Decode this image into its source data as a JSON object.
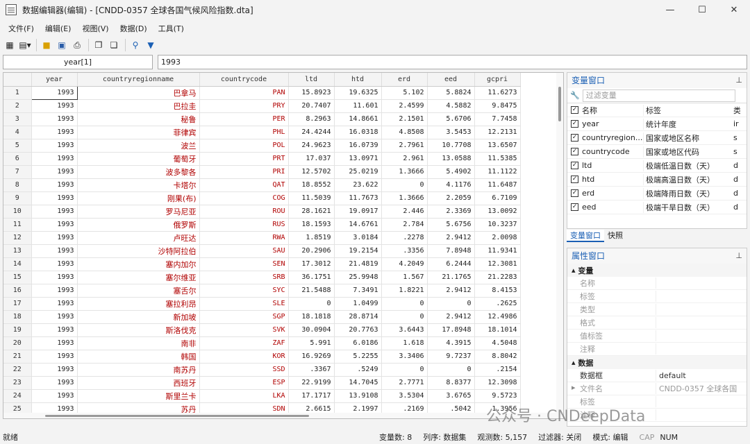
{
  "window": {
    "title": "数据编辑器(编辑) - [CNDD-0357 全球各国气候风险指数.dta]",
    "minimize": "—",
    "maximize": "☐",
    "close": "✕"
  },
  "menu": [
    "文件(F)",
    "编辑(E)",
    "视图(V)",
    "数据(D)",
    "工具(T)"
  ],
  "toolbar_icons": [
    "grid-edit-icon",
    "grid-browse-icon",
    "open-folder-icon",
    "save-icon",
    "print-icon",
    "copy-icon",
    "paste-icon",
    "search-icon",
    "filter-icon"
  ],
  "varbar": {
    "varname": "year[1]",
    "value": "1993"
  },
  "grid": {
    "columns": [
      "year",
      "countryregionname",
      "countrycode",
      "ltd",
      "htd",
      "erd",
      "eed",
      "gcpri"
    ],
    "rows": [
      [
        "1",
        "1993",
        "巴拿马",
        "PAN",
        "15.8923",
        "19.6325",
        "5.102",
        "5.8824",
        "11.6273"
      ],
      [
        "2",
        "1993",
        "巴拉圭",
        "PRY",
        "20.7407",
        "11.601",
        "2.4599",
        "4.5882",
        "9.8475"
      ],
      [
        "3",
        "1993",
        "秘鲁",
        "PER",
        "8.2963",
        "14.8661",
        "2.1501",
        "5.6706",
        "7.7458"
      ],
      [
        "4",
        "1993",
        "菲律宾",
        "PHL",
        "24.4244",
        "16.0318",
        "4.8508",
        "3.5453",
        "12.2131"
      ],
      [
        "5",
        "1993",
        "波兰",
        "POL",
        "24.9623",
        "16.0739",
        "2.7961",
        "10.7708",
        "13.6507"
      ],
      [
        "6",
        "1993",
        "葡萄牙",
        "PRT",
        "17.037",
        "13.0971",
        "2.961",
        "13.0588",
        "11.5385"
      ],
      [
        "7",
        "1993",
        "波多黎各",
        "PRI",
        "12.5702",
        "25.0219",
        "1.3666",
        "5.4902",
        "11.1122"
      ],
      [
        "8",
        "1993",
        "卡塔尔",
        "QAT",
        "18.8552",
        "23.622",
        "0",
        "4.1176",
        "11.6487"
      ],
      [
        "9",
        "1993",
        "刚果(布)",
        "COG",
        "11.5039",
        "11.7673",
        "1.3666",
        "2.2059",
        "6.7109"
      ],
      [
        "10",
        "1993",
        "罗马尼亚",
        "ROU",
        "28.1621",
        "19.0917",
        "2.446",
        "2.3369",
        "13.0092"
      ],
      [
        "11",
        "1993",
        "俄罗斯",
        "RUS",
        "18.1593",
        "14.6761",
        "2.784",
        "5.6756",
        "10.3237"
      ],
      [
        "12",
        "1993",
        "卢旺达",
        "RWA",
        "1.8519",
        "3.0184",
        ".2278",
        "2.9412",
        "2.0098"
      ],
      [
        "13",
        "1993",
        "沙特阿拉伯",
        "SAU",
        "20.2906",
        "19.2154",
        ".3356",
        "7.8948",
        "11.9341"
      ],
      [
        "14",
        "1993",
        "塞内加尔",
        "SEN",
        "17.3012",
        "21.4819",
        "4.2049",
        "6.2444",
        "12.3081"
      ],
      [
        "15",
        "1993",
        "塞尔维亚",
        "SRB",
        "36.1751",
        "25.9948",
        "1.567",
        "21.1765",
        "21.2283"
      ],
      [
        "16",
        "1993",
        "塞舌尔",
        "SYC",
        "21.5488",
        "7.3491",
        "1.8221",
        "2.9412",
        "8.4153"
      ],
      [
        "17",
        "1993",
        "塞拉利昂",
        "SLE",
        "0",
        "1.0499",
        "0",
        "0",
        ".2625"
      ],
      [
        "18",
        "1993",
        "新加坡",
        "SGP",
        "18.1818",
        "28.8714",
        "0",
        "2.9412",
        "12.4986"
      ],
      [
        "19",
        "1993",
        "斯洛伐克",
        "SVK",
        "30.0904",
        "20.7763",
        "3.6443",
        "17.8948",
        "18.1014"
      ],
      [
        "20",
        "1993",
        "南非",
        "ZAF",
        "5.991",
        "6.0186",
        "1.618",
        "4.3915",
        "4.5048"
      ],
      [
        "21",
        "1993",
        "韩国",
        "KOR",
        "16.9269",
        "5.2255",
        "3.3406",
        "9.7237",
        "8.8042"
      ],
      [
        "22",
        "1993",
        "南苏丹",
        "SSD",
        ".3367",
        ".5249",
        "0",
        "0",
        ".2154"
      ],
      [
        "23",
        "1993",
        "西班牙",
        "ESP",
        "22.9199",
        "14.7045",
        "2.7771",
        "8.8377",
        "12.3098"
      ],
      [
        "24",
        "1993",
        "斯里兰卡",
        "LKA",
        "17.1717",
        "13.9108",
        "3.5304",
        "3.6765",
        "9.5723"
      ],
      [
        "25",
        "1993",
        "苏丹",
        "SDN",
        "2.6615",
        "2.1997",
        ".2169",
        ".5042",
        "1.3956"
      ]
    ]
  },
  "var_window": {
    "title": "变量窗口",
    "pin": "📌",
    "filter_placeholder": "过滤变量",
    "header": {
      "name": "名称",
      "label": "标签",
      "type": "类"
    },
    "vars": [
      {
        "name": "year",
        "label": "统计年度",
        "type": "ir"
      },
      {
        "name": "countryregion...",
        "label": "国家或地区名称",
        "type": "s"
      },
      {
        "name": "countrycode",
        "label": "国家或地区代码",
        "type": "s"
      },
      {
        "name": "ltd",
        "label": "极端低温日数（天）",
        "type": "d"
      },
      {
        "name": "htd",
        "label": "极端高温日数（天）",
        "type": "d"
      },
      {
        "name": "erd",
        "label": "极端降雨日数（天）",
        "type": "d"
      },
      {
        "name": "eed",
        "label": "极端干旱日数（天）",
        "type": "d"
      }
    ]
  },
  "tabs": [
    "变量窗口",
    "快照"
  ],
  "prop_window": {
    "title": "属性窗口",
    "pin": "📌",
    "sec_var": "变量",
    "var_props": [
      "名称",
      "标签",
      "类型",
      "格式",
      "值标签",
      "注释"
    ],
    "sec_data": "数据",
    "data_props": [
      {
        "k": "数据框",
        "v": "default"
      },
      {
        "k": "文件名",
        "v": "CNDD-0357 全球各国"
      },
      {
        "k": "标签",
        "v": ""
      },
      {
        "k": "注释",
        "v": ""
      }
    ]
  },
  "status": {
    "ready": "就绪",
    "vars": "变量数: 8",
    "order": "列序: 数据集",
    "obs": "观测数: 5,157",
    "filter": "过滤器: 关闭",
    "mode": "模式: 编辑",
    "cap": "CAP",
    "num": "NUM"
  },
  "watermark": "公众号 · CNDeepData"
}
